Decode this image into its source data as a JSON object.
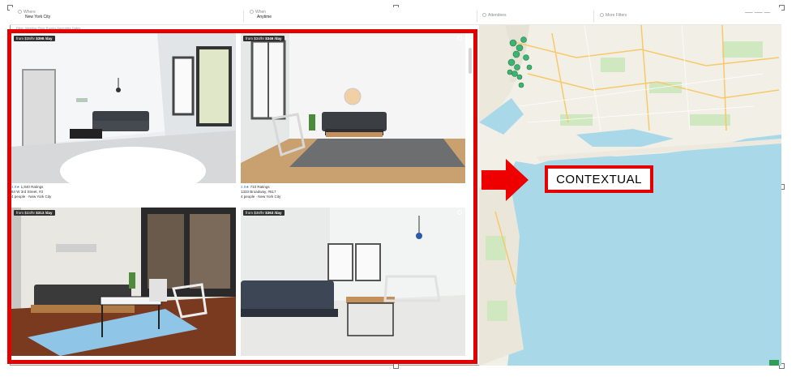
{
  "search": {
    "where_label": "Where",
    "where_value": "New York City",
    "when_label": "When",
    "when_value": "Anytime",
    "attendees_label": "Attendees",
    "filters_label": "More Filters",
    "filter_line": "Filter: Meeting  Price  Rooms  Amenities  Dates"
  },
  "listings": [
    {
      "price_from": "from $38/hr",
      "price_day": "$398 /day",
      "rating": "4.9★",
      "reviews": "1,840 Ratings",
      "address": "84 W 3rd Street, #3",
      "capacity": "4 people · New York City"
    },
    {
      "price_from": "from $34/hr",
      "price_day": "$346 /day",
      "rating": "4.9★",
      "reviews": "710 Ratings",
      "address": "1333 Broadway, #617",
      "capacity": "4 people · New York City"
    },
    {
      "price_from": "from $33/hr",
      "price_day": "$313 /day",
      "rating": "",
      "reviews": "",
      "address": "",
      "capacity": ""
    },
    {
      "price_from": "from $38/hr",
      "price_day": "$363 /day",
      "rating": "",
      "reviews": "",
      "address": "",
      "capacity": ""
    }
  ],
  "annotation": {
    "label": "CONTEXTUAL"
  },
  "colors": {
    "highlight": "#e50000",
    "water": "#a9d9e8",
    "land": "#f2efe6",
    "park": "#cfe8c0",
    "pin": "#3cb371"
  }
}
